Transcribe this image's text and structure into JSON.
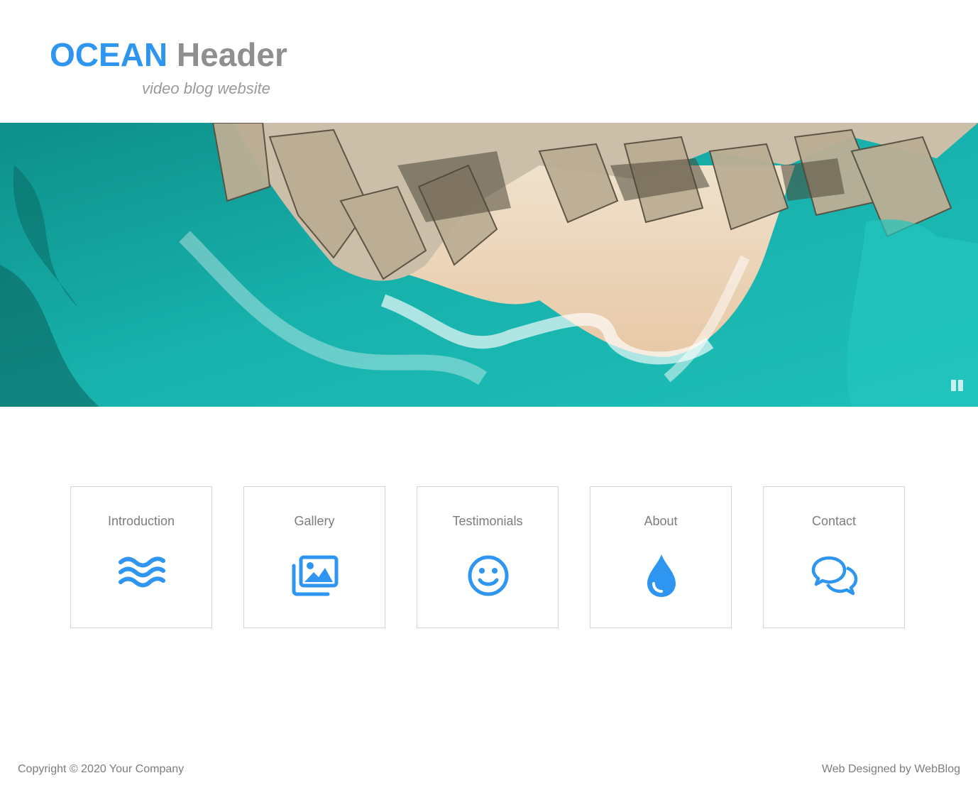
{
  "header": {
    "title_accent": "OCEAN",
    "title_rest": "Header",
    "tagline": "video blog website"
  },
  "hero": {
    "description": "",
    "controls": {
      "pause_icon": "pause-icon"
    }
  },
  "cards": [
    {
      "label": "Introduction",
      "icon": "waves-icon"
    },
    {
      "label": "Gallery",
      "icon": "images-icon"
    },
    {
      "label": "Testimonials",
      "icon": "smile-icon"
    },
    {
      "label": "About",
      "icon": "droplet-icon"
    },
    {
      "label": "Contact",
      "icon": "comments-icon"
    }
  ],
  "footer": {
    "copyright": "Copyright © 2020 Your Company",
    "credit": "Web Designed by WebBlog"
  },
  "colors": {
    "accent": "#2e95f0",
    "title_gray": "#8f8f8f",
    "text_gray": "#7d7d7d",
    "card_border": "#d4d4d4"
  }
}
